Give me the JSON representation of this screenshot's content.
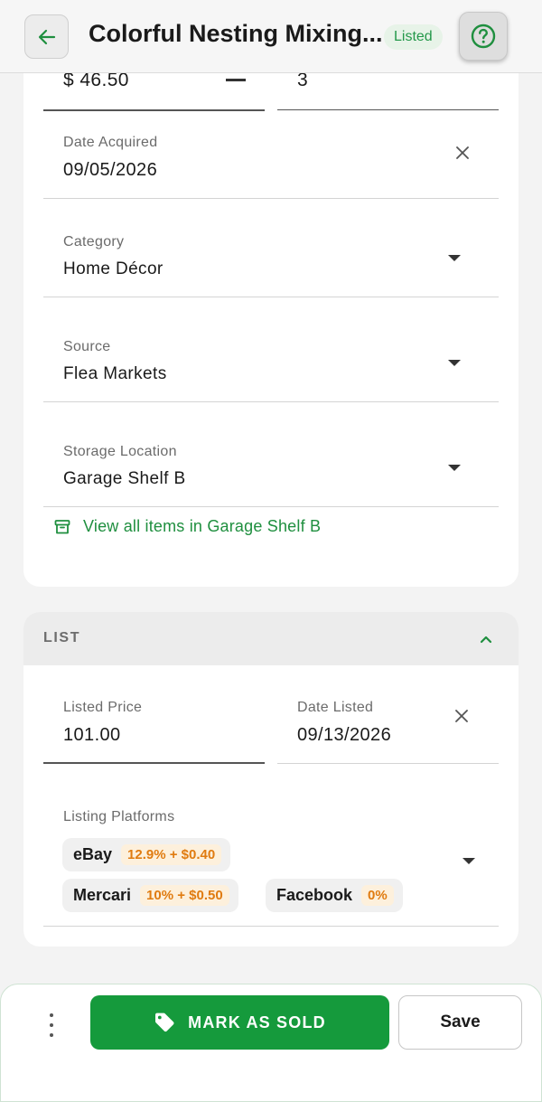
{
  "header": {
    "title": "Colorful Nesting Mixing...",
    "status_badge": "Listed"
  },
  "purchase": {
    "price_value": "$ 46.50",
    "quantity_value": "3",
    "date_acquired": {
      "label": "Date Acquired",
      "value": "09/05/2026"
    },
    "category": {
      "label": "Category",
      "value": "Home Décor"
    },
    "source": {
      "label": "Source",
      "value": "Flea Markets"
    },
    "storage_location": {
      "label": "Storage Location",
      "value": "Garage Shelf B"
    },
    "view_items_link": "View all items in Garage Shelf B"
  },
  "list_section": {
    "title": "LIST",
    "listed_price": {
      "label": "Listed Price",
      "value": "101.00"
    },
    "date_listed": {
      "label": "Date Listed",
      "value": "09/13/2026"
    },
    "platforms": {
      "label": "Listing Platforms",
      "items": [
        {
          "name": "eBay",
          "fee": "12.9% + $0.40"
        },
        {
          "name": "Mercari",
          "fee": "10% + $0.50"
        },
        {
          "name": "Facebook",
          "fee": "0%"
        }
      ]
    }
  },
  "actions": {
    "mark_sold": "MARK AS SOLD",
    "save": "Save"
  },
  "colors": {
    "accent": "#159a3c",
    "fee_text": "#e07b10",
    "badge_bg": "#e7f3e8"
  },
  "icons": [
    "back-arrow-icon",
    "help-icon",
    "clear-icon",
    "dropdown-caret-icon",
    "archive-box-icon",
    "chevron-up-icon",
    "more-vertical-icon",
    "tag-icon"
  ]
}
